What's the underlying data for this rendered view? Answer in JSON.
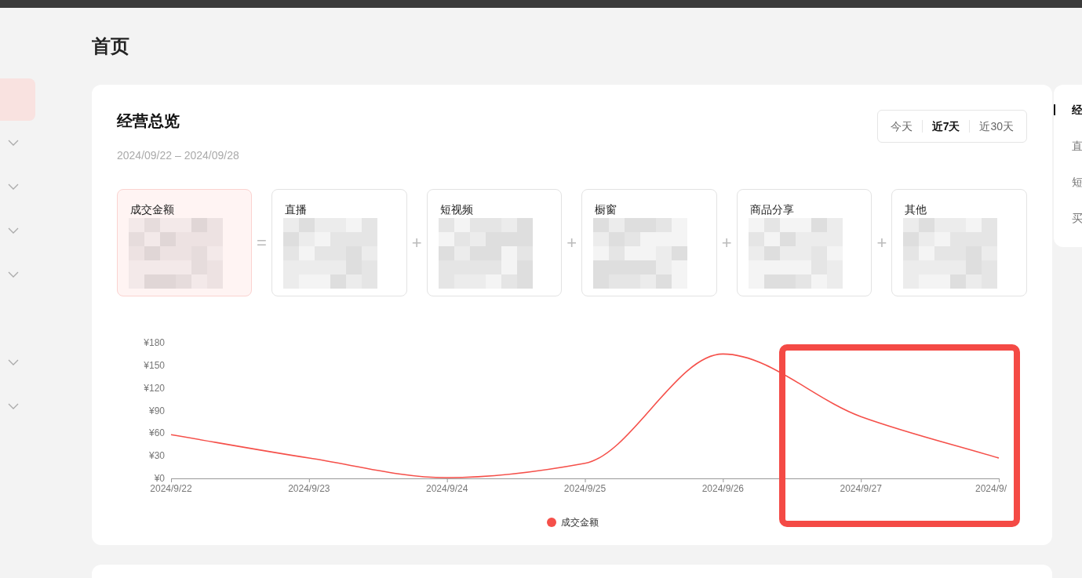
{
  "page_title": "首页",
  "sidebar": {
    "items": [
      {
        "selected": true,
        "expandable": false
      },
      {
        "selected": false,
        "expandable": true
      },
      {
        "selected": false,
        "expandable": true
      },
      {
        "selected": false,
        "expandable": true
      },
      {
        "selected": false,
        "expandable": true
      },
      {
        "selected": false,
        "expandable": false
      },
      {
        "selected": false,
        "expandable": true
      },
      {
        "selected": false,
        "expandable": true
      }
    ]
  },
  "overview": {
    "title": "经营总览",
    "date_range": "2024/09/22 – 2024/09/28",
    "ranges": [
      {
        "label": "今天",
        "selected": false
      },
      {
        "label": "近7天",
        "selected": true
      },
      {
        "label": "近30天",
        "selected": false
      }
    ],
    "metrics": [
      {
        "label": "成交金额",
        "selected": true,
        "redacted": true
      },
      {
        "operator": "=",
        "label": "直播",
        "selected": false,
        "redacted": true
      },
      {
        "operator": "+",
        "label": "短视频",
        "selected": false,
        "redacted": true
      },
      {
        "operator": "+",
        "label": "橱窗",
        "selected": false,
        "redacted": true
      },
      {
        "operator": "+",
        "label": "商品分享",
        "selected": false,
        "redacted": true
      },
      {
        "operator": "+",
        "label": "其他",
        "selected": false,
        "redacted": true
      }
    ],
    "highlight": true,
    "chart_data": {
      "type": "line",
      "categories": [
        "2024/9/22",
        "2024/9/23",
        "2024/9/24",
        "2024/9/25",
        "2024/9/26",
        "2024/9/27",
        "2024/9/"
      ],
      "series": [
        {
          "name": "成交金额",
          "color": "#f5504a",
          "values": [
            58,
            27,
            1,
            20,
            165,
            82,
            27
          ]
        }
      ],
      "ylim": [
        0,
        180
      ],
      "yticks": [
        {
          "value": 0,
          "label": "¥0"
        },
        {
          "value": 30,
          "label": "¥30"
        },
        {
          "value": 60,
          "label": "¥60"
        },
        {
          "value": 90,
          "label": "¥90"
        },
        {
          "value": 120,
          "label": "¥120"
        },
        {
          "value": 150,
          "label": "¥150"
        },
        {
          "value": 180,
          "label": "¥180"
        }
      ]
    }
  },
  "anchor_nav": {
    "items": [
      {
        "label": "经",
        "selected": true
      },
      {
        "label": "直",
        "selected": false
      },
      {
        "label": "短",
        "selected": false
      },
      {
        "label": "买",
        "selected": false
      }
    ]
  }
}
